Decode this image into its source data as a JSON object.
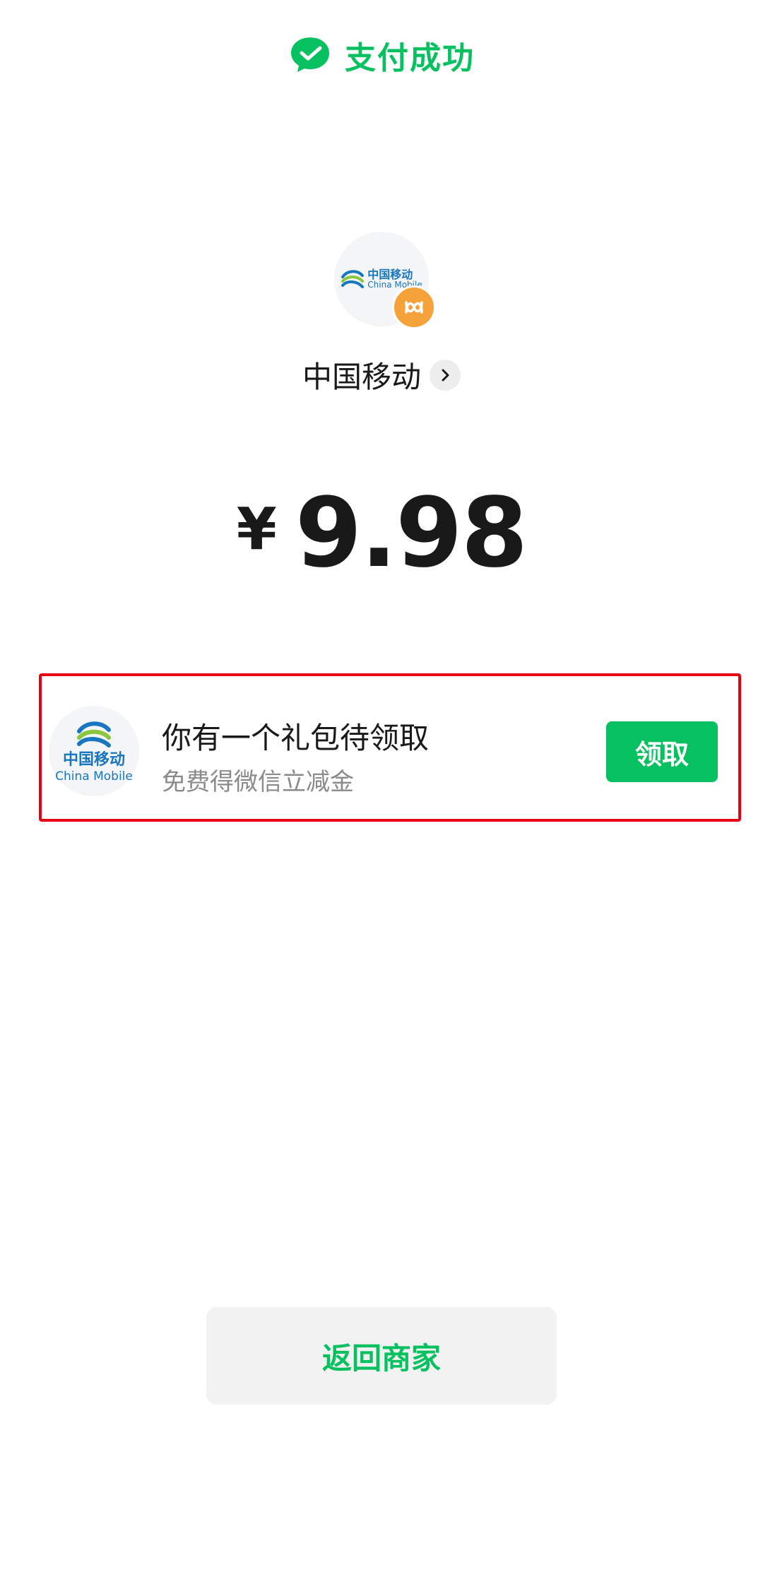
{
  "header": {
    "title": "支付成功",
    "icon": "wechat-pay-check-icon",
    "accent_color": "#07c160"
  },
  "merchant": {
    "logo_text_zh": "中国移动",
    "logo_text_en": "China Mobile",
    "badge_icon": "mini-program-icon",
    "name": "中国移动",
    "chevron_icon": "chevron-right-icon"
  },
  "payment": {
    "currency": "¥",
    "amount": "9.98"
  },
  "gift": {
    "logo_text_zh": "中国移动",
    "logo_text_en": "China Mobile",
    "title": "你有一个礼包待领取",
    "subtitle": "免费得微信立减金",
    "claim_label": "领取",
    "highlight_color": "#e60012"
  },
  "footer": {
    "return_label": "返回商家"
  }
}
